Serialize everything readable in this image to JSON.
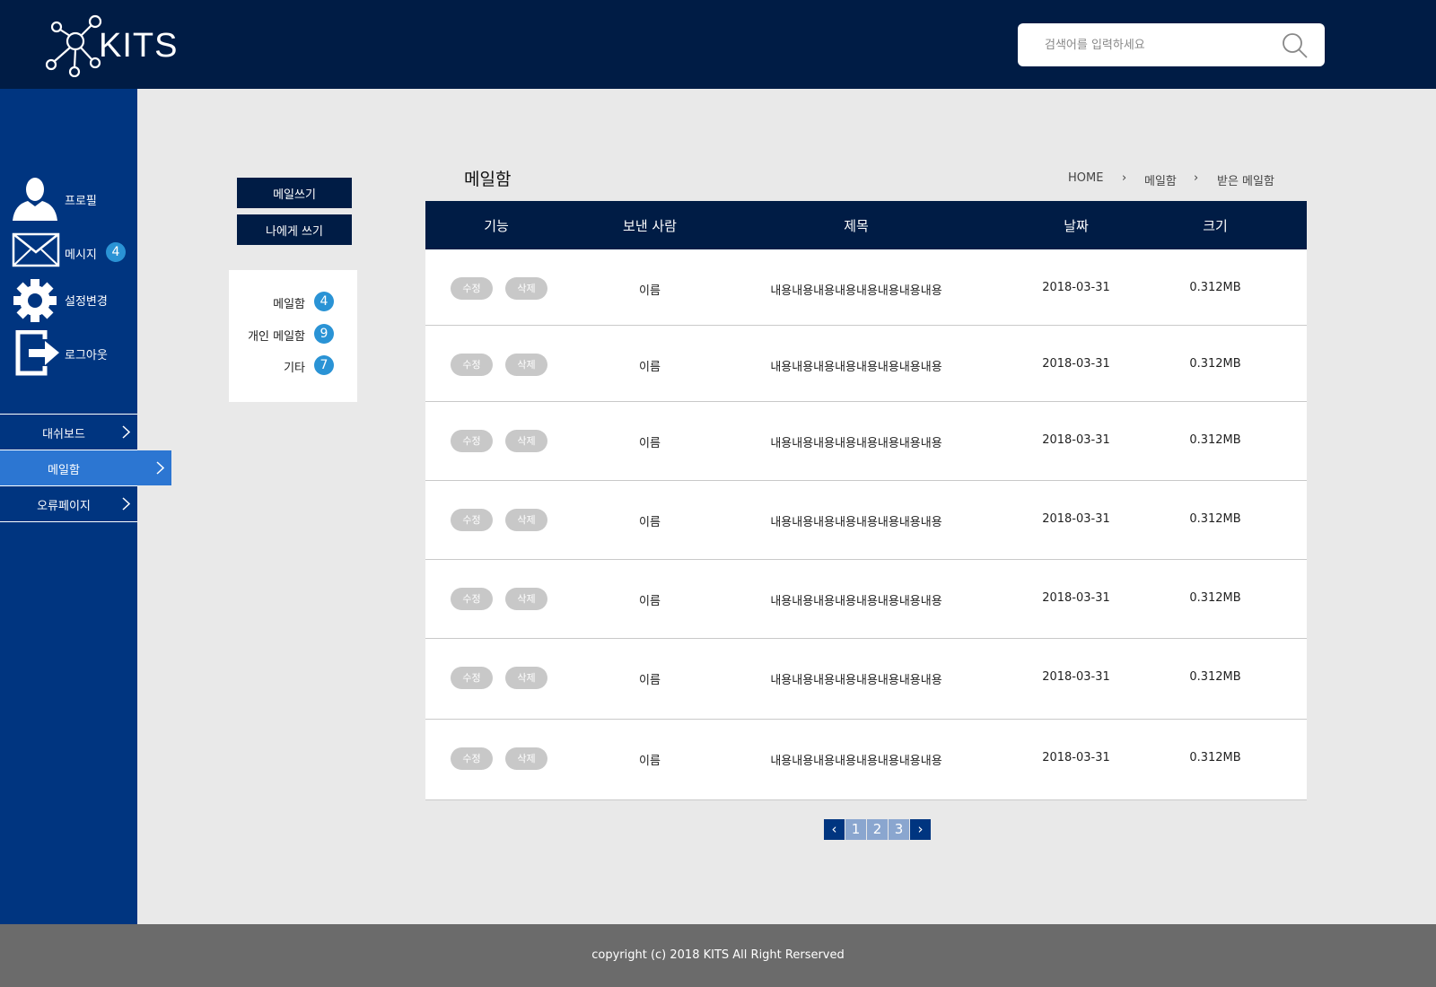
{
  "header": {
    "logo_text": "KITS",
    "search_placeholder": "검색어를 입력하세요"
  },
  "sidebar": {
    "profile_label": "프로필",
    "message_label": "메시지",
    "message_count": "4",
    "settings_label": "설정변경",
    "logout_label": "로그아웃",
    "nav": [
      {
        "label": "대쉬보드"
      },
      {
        "label": "메일함",
        "active": true
      },
      {
        "label": "오류페이지"
      }
    ]
  },
  "actions": {
    "compose": "메일쓰기",
    "write_to_self": "나에게 쓰기"
  },
  "mailboxes": [
    {
      "label": "메일함",
      "count": "4"
    },
    {
      "label": "개인 메일함",
      "count": "9"
    },
    {
      "label": "기타",
      "count": "7"
    }
  ],
  "page": {
    "title": "메일함",
    "breadcrumb": [
      "HOME",
      "메일함",
      "받은 메일함"
    ]
  },
  "table": {
    "headers": [
      "기능",
      "보낸 사람",
      "제목",
      "날짜",
      "크기"
    ],
    "edit_label": "수정",
    "delete_label": "삭제",
    "rows": [
      {
        "sender": "이름",
        "subject": "내용내용내용내용내용내용내용내용",
        "date": "2018-03-31",
        "size": "0.312MB"
      },
      {
        "sender": "이름",
        "subject": "내용내용내용내용내용내용내용내용",
        "date": "2018-03-31",
        "size": "0.312MB"
      },
      {
        "sender": "이름",
        "subject": "내용내용내용내용내용내용내용내용",
        "date": "2018-03-31",
        "size": "0.312MB"
      },
      {
        "sender": "이름",
        "subject": "내용내용내용내용내용내용내용내용",
        "date": "2018-03-31",
        "size": "0.312MB"
      },
      {
        "sender": "이름",
        "subject": "내용내용내용내용내용내용내용내용",
        "date": "2018-03-31",
        "size": "0.312MB"
      },
      {
        "sender": "이름",
        "subject": "내용내용내용내용내용내용내용내용",
        "date": "2018-03-31",
        "size": "0.312MB"
      },
      {
        "sender": "이름",
        "subject": "내용내용내용내용내용내용내용내용",
        "date": "2018-03-31",
        "size": "0.312MB"
      }
    ]
  },
  "pagination": {
    "pages": [
      "1",
      "2",
      "3"
    ]
  },
  "footer": {
    "copyright": "copyright (c) 2018 KITS All Right Rerserved"
  },
  "colors": {
    "header_bg": "#001c45",
    "sidebar_bg": "#003580",
    "active_nav": "#2c76d2",
    "badge": "#2a93d5",
    "footer_bg": "#6b6b6b"
  }
}
